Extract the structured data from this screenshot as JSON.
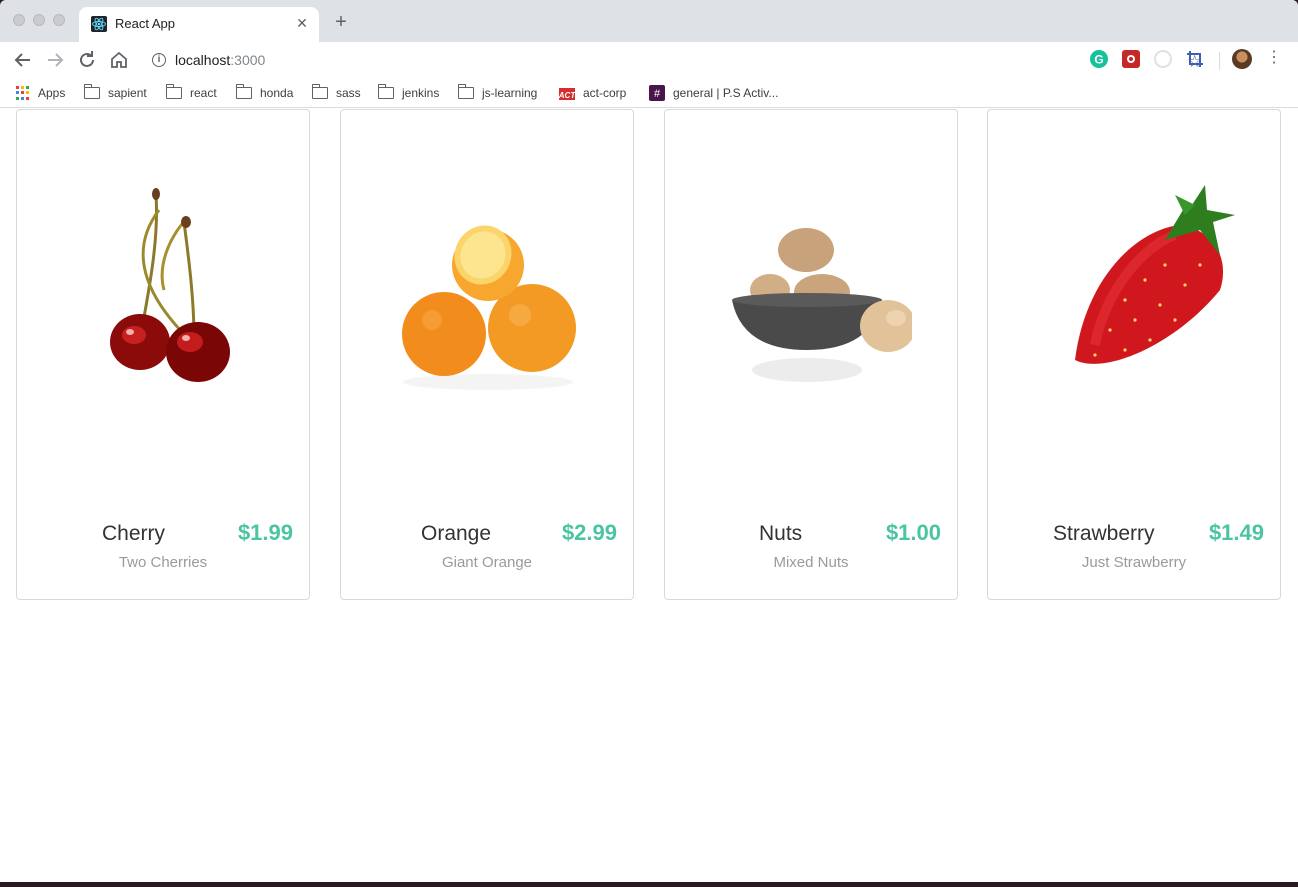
{
  "browser": {
    "tab_title": "React App",
    "url_host": "localhost",
    "url_port": ":3000"
  },
  "bookmarks": [
    {
      "label": "Apps",
      "icon": "apps-icon"
    },
    {
      "label": "sapient",
      "icon": "folder-icon"
    },
    {
      "label": "react",
      "icon": "folder-icon"
    },
    {
      "label": "honda",
      "icon": "folder-icon"
    },
    {
      "label": "sass",
      "icon": "folder-icon"
    },
    {
      "label": "jenkins",
      "icon": "folder-icon"
    },
    {
      "label": "js-learning",
      "icon": "folder-icon"
    },
    {
      "label": "act-corp",
      "icon": "act-logo-icon"
    },
    {
      "label": "general | P.S Activ...",
      "icon": "slack-hash-icon"
    }
  ],
  "products": [
    {
      "name": "Cherry",
      "price": "$1.99",
      "description": "Two Cherries",
      "image": "cherry-image"
    },
    {
      "name": "Orange",
      "price": "$2.99",
      "description": "Giant Orange",
      "image": "orange-image"
    },
    {
      "name": "Nuts",
      "price": "$1.00",
      "description": "Mixed Nuts",
      "image": "nuts-image"
    },
    {
      "name": "Strawberry",
      "price": "$1.49",
      "description": "Just Strawberry",
      "image": "strawberry-image"
    }
  ],
  "colors": {
    "price": "#4bc4a4",
    "card_border": "#d8d8d8"
  }
}
